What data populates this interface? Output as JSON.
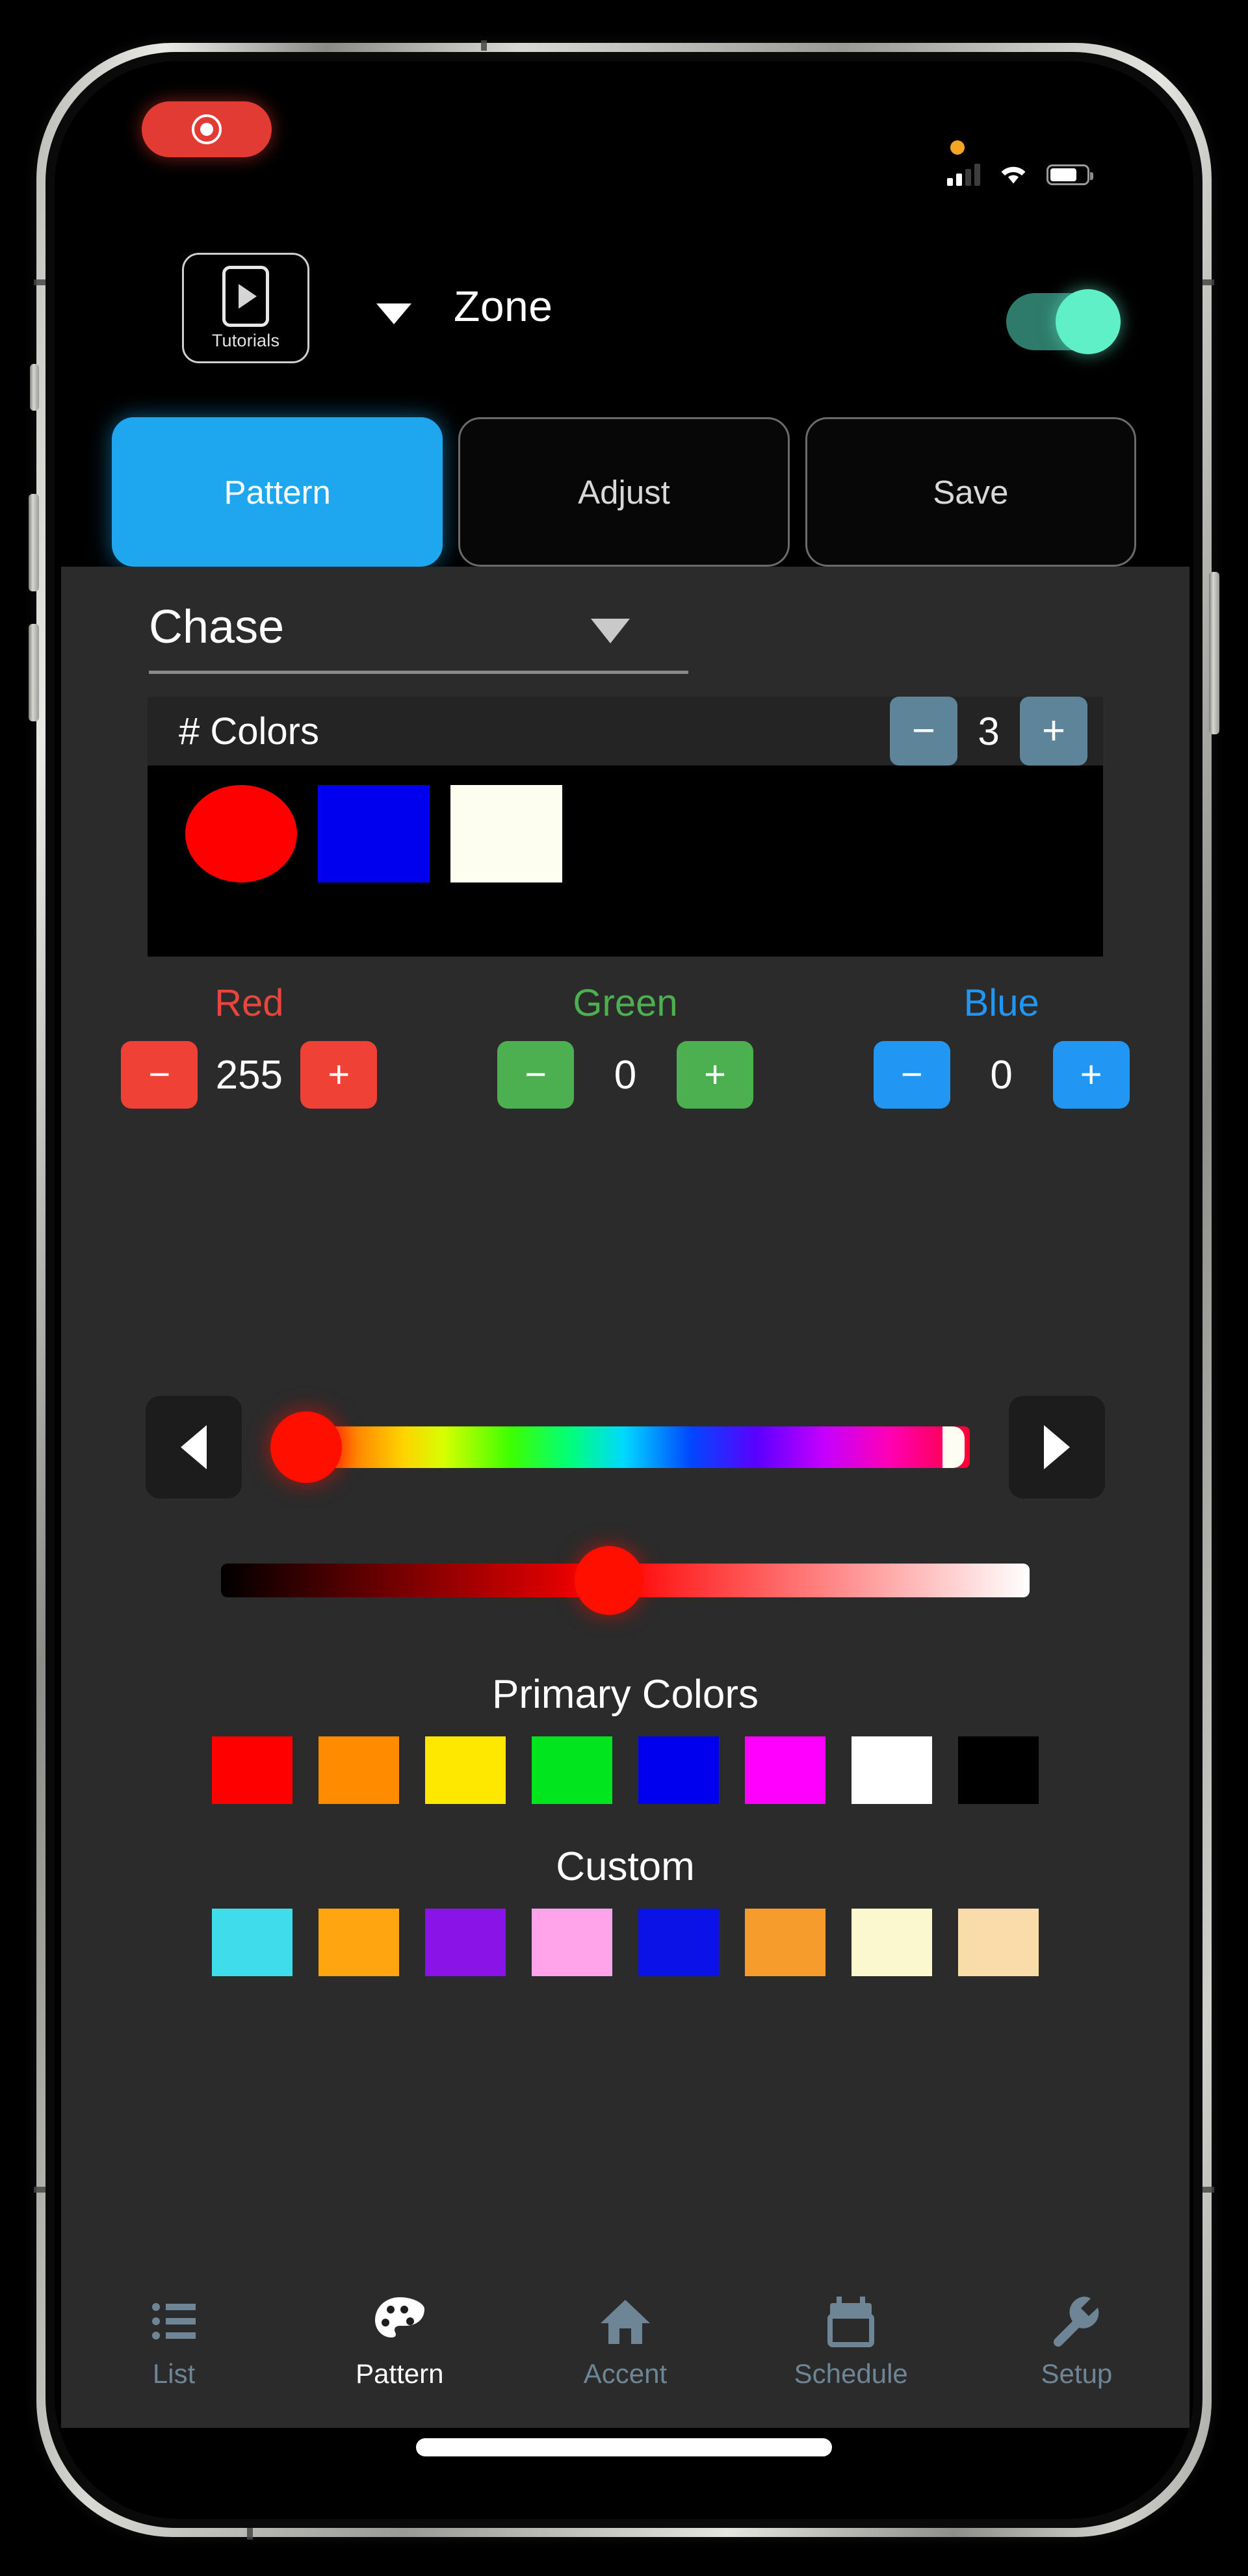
{
  "status_bar": {
    "recording_indicator": "record-pill",
    "privacy_dot": "microphone-in-use",
    "signal_bars_filled": 2,
    "signal_bars_total": 4,
    "wifi": "wifi-icon",
    "battery_level_pct": 74
  },
  "header": {
    "tutorials_label": "Tutorials",
    "tutorials_icon": "video-play-icon",
    "zone_caret_icon": "chevron-down-icon",
    "zone_label": "Zone",
    "zone_toggle_on": true,
    "toggle_track_color": "#2e7a6b",
    "toggle_knob_color": "#5ff0c8"
  },
  "tabs": [
    {
      "label": "Pattern",
      "active": true
    },
    {
      "label": "Adjust",
      "active": false
    },
    {
      "label": "Save",
      "active": false
    }
  ],
  "tab_active_color": "#1ea7ee",
  "pattern": {
    "selected": "Chase",
    "caret_icon": "chevron-down-icon"
  },
  "colors_panel": {
    "title": "# Colors",
    "count": "3",
    "minus_label": "−",
    "plus_label": "+",
    "stepper_color": "#5d8499",
    "swatches": [
      {
        "color": "#ff0000",
        "selected": true,
        "shape": "circle"
      },
      {
        "color": "#0000ee",
        "selected": false,
        "shape": "square"
      },
      {
        "color": "#fdfdf0",
        "selected": false,
        "shape": "square"
      }
    ]
  },
  "rgb": {
    "channels": [
      {
        "name": "Red",
        "value": "255",
        "color": "#e8453c",
        "btn_color": "#ef4136",
        "cls": "r"
      },
      {
        "name": "Green",
        "value": "0",
        "color": "#4caf50",
        "btn_color": "#4caf50",
        "cls": "g"
      },
      {
        "name": "Blue",
        "value": "0",
        "color": "#2196f3",
        "btn_color": "#2196f3",
        "cls": "b"
      }
    ],
    "minus_label": "−",
    "plus_label": "+"
  },
  "hue_slider": {
    "left_arrow_icon": "arrow-left-icon",
    "right_arrow_icon": "arrow-right-icon",
    "knob_color": "#ff0f00",
    "position_pct": 0
  },
  "brightness_slider": {
    "knob_color": "#ff0f00",
    "position_pct": 48,
    "from": "#000000",
    "mid": "#ff0000",
    "to": "#ffffff"
  },
  "primary_palette": {
    "title": "Primary Colors",
    "colors": [
      "#ff0000",
      "#ff8c00",
      "#ffe800",
      "#00e51e",
      "#0000ee",
      "#ff00ff",
      "#ffffff",
      "#000000"
    ]
  },
  "custom_palette": {
    "title": "Custom",
    "colors": [
      "#3fdcec",
      "#ffa510",
      "#8a13e8",
      "#ffa3ea",
      "#0a12e8",
      "#f59c2c",
      "#fbf8d0",
      "#fadcaa"
    ]
  },
  "bottom_nav": [
    {
      "label": "List",
      "icon": "list-icon",
      "active": false
    },
    {
      "label": "Pattern",
      "icon": "palette-icon",
      "active": true
    },
    {
      "label": "Accent",
      "icon": "home-icon",
      "active": false
    },
    {
      "label": "Schedule",
      "icon": "calendar-icon",
      "active": false
    },
    {
      "label": "Setup",
      "icon": "wrench-icon",
      "active": false
    }
  ],
  "nav_inactive_color": "#6e8595",
  "nav_active_color": "#ffffff"
}
